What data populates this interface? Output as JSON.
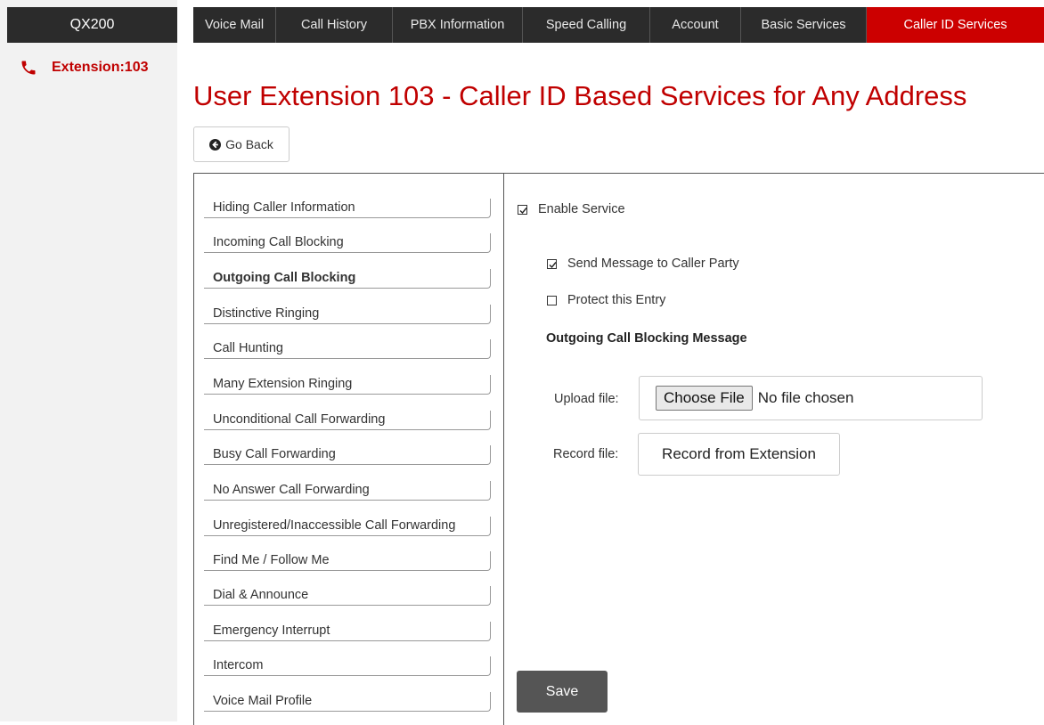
{
  "brand": "QX200",
  "extension_label": "Extension:103",
  "nav": {
    "tabs": [
      {
        "label": "Voice Mail"
      },
      {
        "label": "Call History"
      },
      {
        "label": "PBX Information"
      },
      {
        "label": "Speed Calling"
      },
      {
        "label": "Account"
      },
      {
        "label": "Basic Services"
      },
      {
        "label": "Caller ID Services",
        "active": true
      }
    ]
  },
  "page_title": "User Extension 103 - Caller ID Based Services for Any Address",
  "go_back_label": "Go Back",
  "services": [
    "Hiding Caller Information",
    "Incoming Call Blocking",
    "Outgoing Call Blocking",
    "Distinctive Ringing",
    "Call Hunting",
    "Many Extension Ringing",
    "Unconditional Call Forwarding",
    "Busy Call Forwarding",
    "No Answer Call Forwarding",
    "Unregistered/Inaccessible Call Forwarding",
    "Find Me / Follow Me",
    "Dial & Announce",
    "Emergency Interrupt",
    "Intercom",
    "Voice Mail Profile"
  ],
  "active_service": "Outgoing Call Blocking",
  "form": {
    "enable_service": {
      "label": "Enable Service",
      "checked": true
    },
    "send_message": {
      "label": "Send Message to Caller Party",
      "checked": true
    },
    "protect_entry": {
      "label": "Protect this Entry",
      "checked": false
    },
    "message_heading": "Outgoing Call Blocking Message",
    "upload_label": "Upload file:",
    "choose_file_label": "Choose File",
    "no_file_text": "No file chosen",
    "record_label": "Record file:",
    "record_button_label": "Record from Extension",
    "save_label": "Save"
  },
  "colors": {
    "accent": "#cc0000",
    "nav_bg": "#2b2b2b",
    "save_bg": "#555555"
  },
  "icons": {
    "phone": "phone-icon",
    "back": "circle-arrow-left-icon",
    "check": "checkmark-icon"
  }
}
